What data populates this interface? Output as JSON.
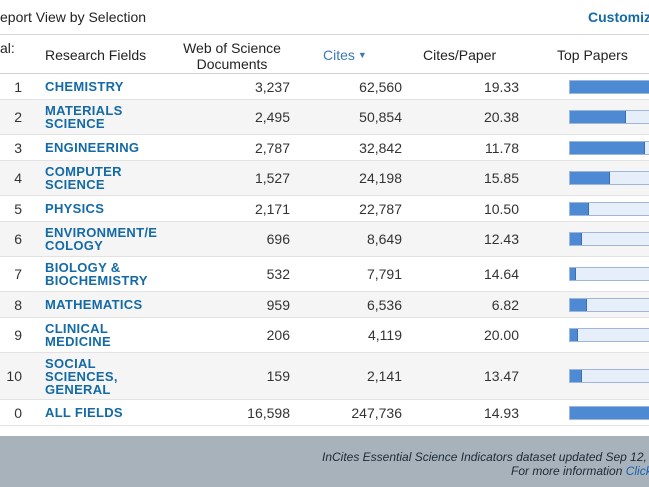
{
  "header": {
    "title": "eport View by Selection",
    "customize_label": "Customiz"
  },
  "columns": {
    "rank": "al:",
    "field": "Research Fields",
    "docs_line1": "Web of Science",
    "docs_line2": "Documents",
    "cites": "Cites",
    "cites_sort_icon": "sort-desc-icon",
    "cites_per_paper": "Cites/Paper",
    "top_papers": "Top Papers"
  },
  "rows": [
    {
      "rank": "1",
      "field_lines": [
        "CHEMISTRY"
      ],
      "docs": "3,237",
      "cites": "62,560",
      "cpp": "19.33",
      "top_papers_fraction": 0.93
    },
    {
      "rank": "2",
      "field_lines": [
        "MATERIALS",
        "SCIENCE"
      ],
      "docs": "2,495",
      "cites": "50,854",
      "cpp": "20.38",
      "top_papers_fraction": 0.62
    },
    {
      "rank": "3",
      "field_lines": [
        "ENGINEERING"
      ],
      "docs": "2,787",
      "cites": "32,842",
      "cpp": "11.78",
      "top_papers_fraction": 0.84
    },
    {
      "rank": "4",
      "field_lines": [
        "COMPUTER",
        "SCIENCE"
      ],
      "docs": "1,527",
      "cites": "24,198",
      "cpp": "15.85",
      "top_papers_fraction": 0.44
    },
    {
      "rank": "5",
      "field_lines": [
        "PHYSICS"
      ],
      "docs": "2,171",
      "cites": "22,787",
      "cpp": "10.50",
      "top_papers_fraction": 0.2
    },
    {
      "rank": "6",
      "field_lines": [
        "ENVIRONMENT/E",
        "COLOGY"
      ],
      "docs": "696",
      "cites": "8,649",
      "cpp": "12.43",
      "top_papers_fraction": 0.12
    },
    {
      "rank": "7",
      "field_lines": [
        "BIOLOGY &",
        "BIOCHEMISTRY"
      ],
      "docs": "532",
      "cites": "7,791",
      "cpp": "14.64",
      "top_papers_fraction": 0.06
    },
    {
      "rank": "8",
      "field_lines": [
        "MATHEMATICS"
      ],
      "docs": "959",
      "cites": "6,536",
      "cpp": "6.82",
      "top_papers_fraction": 0.18
    },
    {
      "rank": "9",
      "field_lines": [
        "CLINICAL",
        "MEDICINE"
      ],
      "docs": "206",
      "cites": "4,119",
      "cpp": "20.00",
      "top_papers_fraction": 0.08
    },
    {
      "rank": "10",
      "field_lines": [
        "SOCIAL",
        "SCIENCES,",
        "GENERAL"
      ],
      "docs": "159",
      "cites": "2,141",
      "cpp": "13.47",
      "top_papers_fraction": 0.12
    },
    {
      "rank": "0",
      "field_lines": [
        "ALL FIELDS"
      ],
      "docs": "16,598",
      "cites": "247,736",
      "cpp": "14.93",
      "top_papers_fraction": 1.0
    }
  ],
  "footer": {
    "line1": "InCites Essential Science Indicators dataset updated Sep 12,",
    "line2_prefix": "For more information ",
    "line2_link": "Click"
  },
  "colors": {
    "link": "#136aa6",
    "bar_fill": "#4d8ad3",
    "bar_track": "#e6eefa",
    "footer_bg": "#a8b2ba"
  }
}
